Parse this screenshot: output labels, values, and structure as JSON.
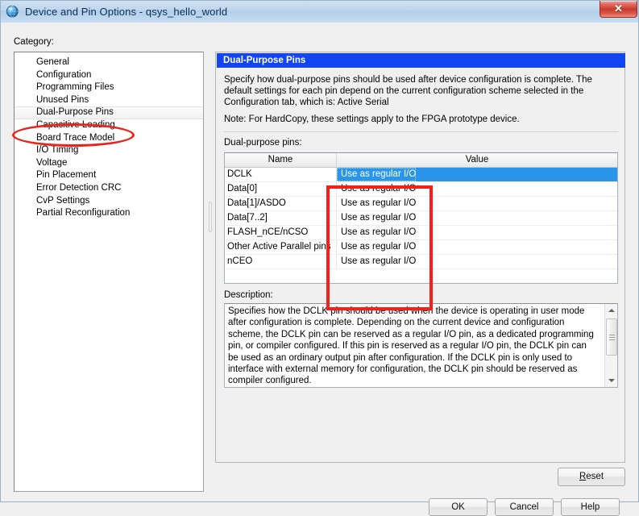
{
  "window": {
    "title": "Device and Pin Options - qsys_hello_world",
    "icon": "globe-icon",
    "close_glyph": "✕"
  },
  "category": {
    "label": "Category:",
    "items": [
      "General",
      "Configuration",
      "Programming Files",
      "Unused Pins",
      "Dual-Purpose Pins",
      "Capacitive Loading",
      "Board Trace Model",
      "I/O Timing",
      "Voltage",
      "Pin Placement",
      "Error Detection CRC",
      "CvP Settings",
      "Partial Reconfiguration"
    ],
    "selected": "Dual-Purpose Pins"
  },
  "panel": {
    "header": "Dual-Purpose Pins",
    "intro": "Specify how dual-purpose pins should be used after device configuration is complete. The default settings for each pin depend on the current configuration scheme selected in the Configuration tab, which is:  Active Serial",
    "note": "Note: For HardCopy, these settings apply to the FPGA prototype device.",
    "table_label": "Dual-purpose pins:"
  },
  "table": {
    "columns": [
      "Name",
      "Value"
    ],
    "rows": [
      {
        "name": "DCLK",
        "value": "Use as regular I/O",
        "selected": true
      },
      {
        "name": "Data[0]",
        "value": "Use as regular I/O",
        "selected": false
      },
      {
        "name": "Data[1]/ASDO",
        "value": "Use as regular I/O",
        "selected": false
      },
      {
        "name": "Data[7..2]",
        "value": "Use as regular I/O",
        "selected": false
      },
      {
        "name": "FLASH_nCE/nCSO",
        "value": "Use as regular I/O",
        "selected": false
      },
      {
        "name": "Other Active Parallel pins",
        "value": "Use as regular I/O",
        "selected": false
      },
      {
        "name": "nCEO",
        "value": "Use as regular I/O",
        "selected": false
      }
    ]
  },
  "description": {
    "label": "Description:",
    "text": "Specifies how the DCLK pin should be used when the device is operating in user mode after configuration is complete. Depending on the current device and configuration scheme, the DCLK pin can be reserved as a regular I/O pin, as a dedicated programming pin, or compiler configured. If this pin is reserved as a regular I/O pin, the DCLK pin can be used as an ordinary output pin after configuration. If the DCLK pin is only used to interface with external memory for configuration, the DCLK pin should be reserved as compiler configured."
  },
  "buttons": {
    "reset": "Reset",
    "reset_mnemonic": "R",
    "reset_rest": "eset",
    "ok": "OK",
    "cancel": "Cancel",
    "help": "Help"
  },
  "colors": {
    "header_blue": "#1346f0",
    "selection_blue": "#2a96eb",
    "annotation_red": "#e8241c",
    "titlebar_blue": "#bfd6ed",
    "close_red": "#c93a2d"
  }
}
